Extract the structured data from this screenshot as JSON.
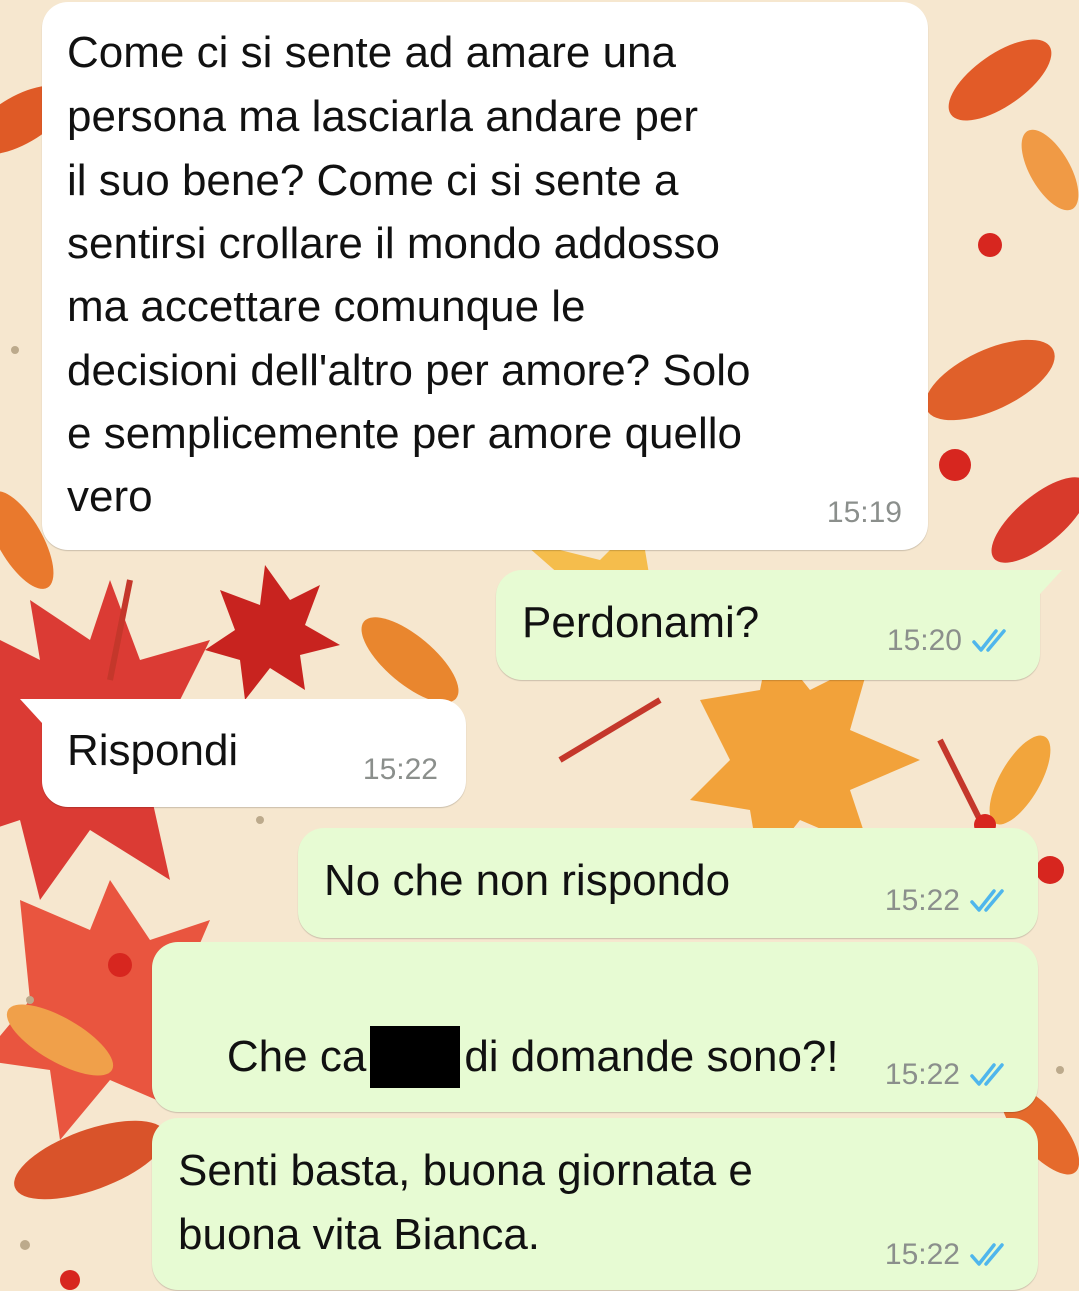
{
  "conversation": {
    "messages": [
      {
        "direction": "incoming",
        "lines": [
          "Come ci si sente ad amare una",
          "persona ma lasciarla andare per",
          "il suo bene? Come ci si sente a",
          "sentirsi crollare il mondo addosso",
          "ma accettare comunque le",
          "decisioni dell'altro per amore? Solo",
          "e semplicemente per amore quello",
          "vero"
        ],
        "time": "15:19"
      },
      {
        "direction": "outgoing",
        "text": "Perdonami?",
        "time": "15:20",
        "status": "read"
      },
      {
        "direction": "incoming",
        "text": "Rispondi",
        "time": "15:22"
      },
      {
        "direction": "outgoing",
        "text": "No che non rispondo",
        "time": "15:22",
        "status": "read"
      },
      {
        "direction": "outgoing",
        "text_before_redaction": "Che ca",
        "text_after_redaction": "di domande sono?!",
        "time": "15:22",
        "status": "read"
      },
      {
        "direction": "outgoing",
        "lines": [
          "Senti basta, buona giornata e",
          "buona vita Bianca."
        ],
        "time": "15:22",
        "status": "read"
      }
    ]
  },
  "theme": {
    "incoming_bubble": "#ffffff",
    "outgoing_bubble": "#e7fbd3",
    "timestamp_color": "#8b8f8c",
    "read_tick_color": "#4fb6ec",
    "wallpaper_base": "#f6e7cf",
    "wallpaper_motif": "autumn-leaves"
  }
}
